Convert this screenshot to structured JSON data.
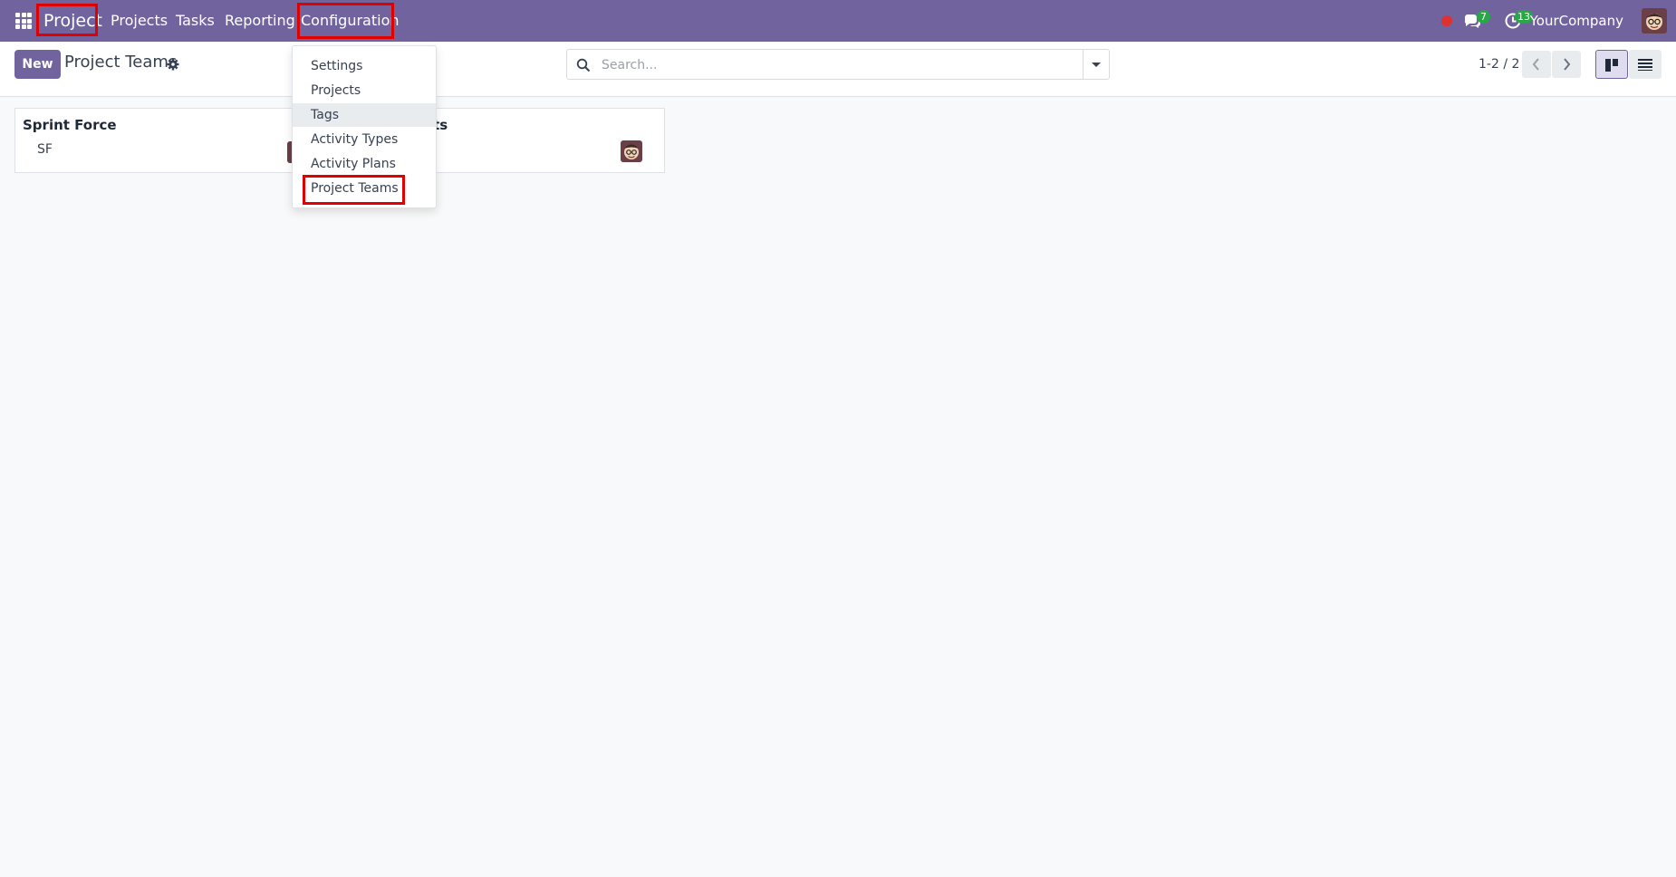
{
  "navbar": {
    "brand": "Project",
    "menu": [
      "Projects",
      "Tasks",
      "Reporting",
      "Configuration"
    ],
    "messages_count": "7",
    "activities_count": "13",
    "company": "YourCompany"
  },
  "control": {
    "new_label": "New",
    "title": "Project Teams",
    "search_placeholder": "Search...",
    "pager": "1-2 / 2"
  },
  "cards": [
    {
      "name": "Sprint Force",
      "code": "SF"
    },
    {
      "name": "ects",
      "code": ""
    }
  ],
  "config_menu": [
    "Settings",
    "Projects",
    "Tags",
    "Activity Types",
    "Activity Plans",
    "Project Teams"
  ],
  "colors": {
    "navbar": "#71639e",
    "highlight": "#e00000",
    "badge": "#28a745",
    "status_dot": "#e03131"
  }
}
